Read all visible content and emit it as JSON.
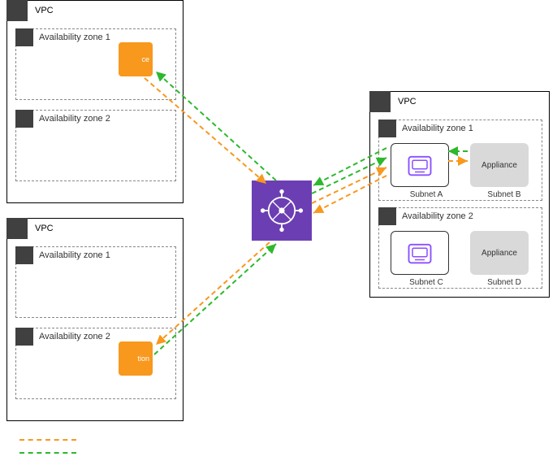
{
  "vpc_left_top": {
    "label": "VPC"
  },
  "vpc_left_bottom": {
    "label": "VPC"
  },
  "vpc_right": {
    "label": "VPC"
  },
  "az": {
    "left_top_1": "Availability zone 1",
    "left_top_2": "Availability zone 2",
    "left_bottom_1": "Availability zone 1",
    "left_bottom_2": "Availability zone 2",
    "right_1": "Availability zone 1",
    "right_2": "Availability zone 2"
  },
  "source_box": {
    "label": "ce"
  },
  "dest_box": {
    "label": "tion"
  },
  "subnets": {
    "a": {
      "label": "Subnet A"
    },
    "b": {
      "label": "Subnet B"
    },
    "c": {
      "label": "Subnet C"
    },
    "d": {
      "label": "Subnet D"
    }
  },
  "appliance": "Appliance",
  "colors": {
    "orange": "#f8981d",
    "green": "#2db82d",
    "purple_icon": "#8c4fff",
    "tgw_bg": "#6b3fb3"
  }
}
